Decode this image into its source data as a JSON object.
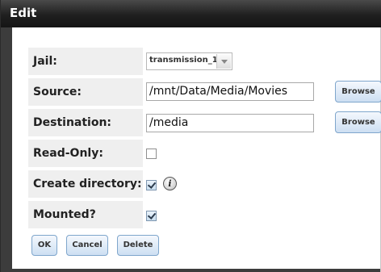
{
  "dialog": {
    "title": "Edit"
  },
  "form": {
    "jail": {
      "label": "Jail:",
      "value": "transmission_1"
    },
    "source": {
      "label": "Source:",
      "value": "/mnt/Data/Media/Movies",
      "browse": "Browse"
    },
    "destination": {
      "label": "Destination:",
      "value": "/media",
      "browse": "Browse"
    },
    "read_only": {
      "label": "Read-Only:",
      "checked": false
    },
    "create_directory": {
      "label": "Create directory:",
      "checked": true,
      "info_icon": "info-icon",
      "info_glyph": "i"
    },
    "mounted": {
      "label": "Mounted?",
      "checked": true
    }
  },
  "buttons": {
    "ok": "OK",
    "cancel": "Cancel",
    "delete": "Delete"
  },
  "colors": {
    "titlebar": "#1f1f1f",
    "label_bg": "#efefef",
    "button_border": "#7fa6cc"
  }
}
